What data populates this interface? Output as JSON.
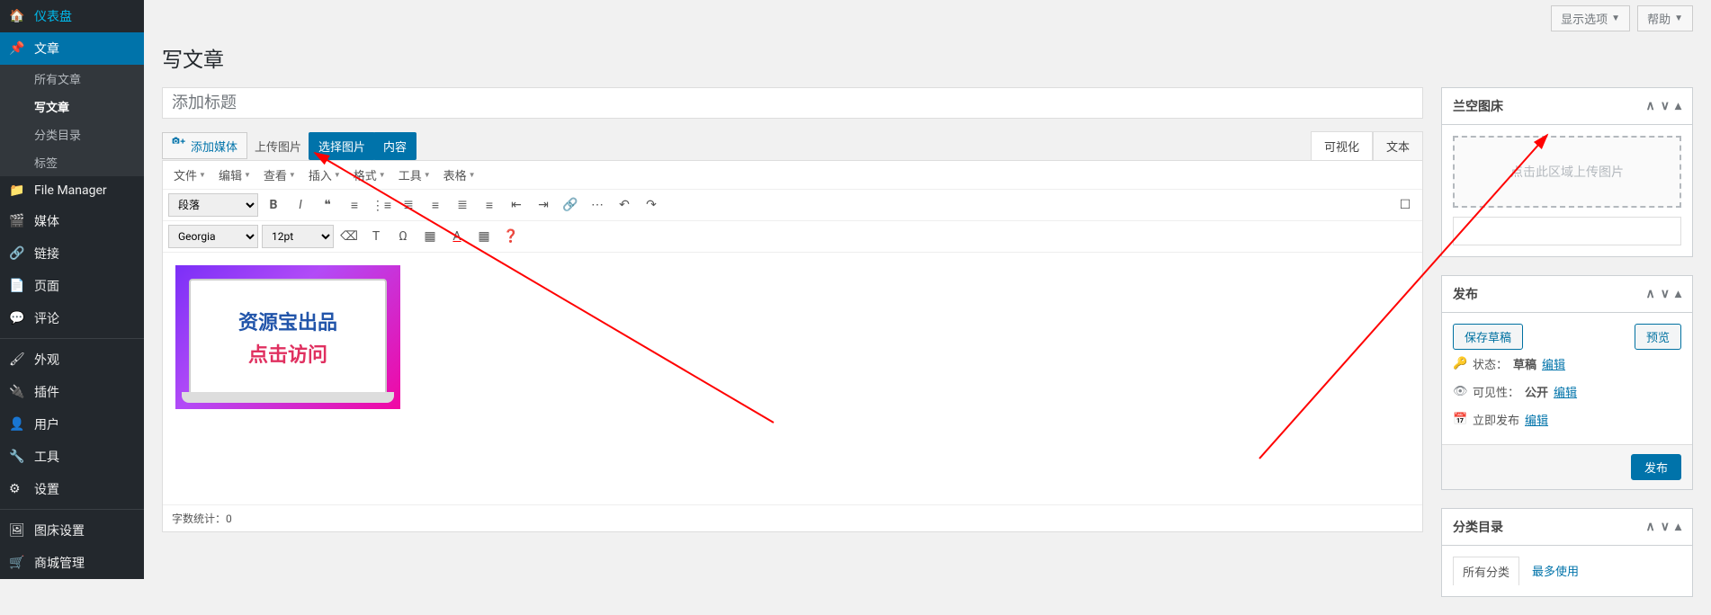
{
  "sidebar": {
    "items": [
      {
        "icon": "dashboard",
        "label": "仪表盘"
      },
      {
        "icon": "pin",
        "label": "文章",
        "current": true
      },
      {
        "icon": "folder",
        "label": "File Manager"
      },
      {
        "icon": "media",
        "label": "媒体"
      },
      {
        "icon": "link",
        "label": "链接"
      },
      {
        "icon": "page",
        "label": "页面"
      },
      {
        "icon": "comment",
        "label": "评论"
      },
      {
        "icon": "brush",
        "label": "外观"
      },
      {
        "icon": "plugin",
        "label": "插件"
      },
      {
        "icon": "user",
        "label": "用户"
      },
      {
        "icon": "wrench",
        "label": "工具"
      },
      {
        "icon": "gear",
        "label": "设置"
      },
      {
        "icon": "image",
        "label": "图床设置"
      },
      {
        "icon": "cart",
        "label": "商城管理"
      }
    ],
    "subitems": [
      "所有文章",
      "写文章",
      "分类目录",
      "标签"
    ],
    "sub_active_index": 1
  },
  "topbar": {
    "screen_options": "显示选项",
    "help": "帮助"
  },
  "page": {
    "title": "写文章",
    "title_placeholder": "添加标题"
  },
  "media_row": {
    "add_media": "添加媒体",
    "upload_img": "上传图片",
    "select_img": "选择图片",
    "content": "内容",
    "tab_visual": "可视化",
    "tab_text": "文本"
  },
  "menubar": [
    "文件",
    "编辑",
    "查看",
    "插入",
    "格式",
    "工具",
    "表格"
  ],
  "toolbar1": {
    "format_select": "段落"
  },
  "toolbar2": {
    "font_select": "Georgia",
    "size_select": "12pt"
  },
  "editor_image": {
    "line1": "资源宝出品",
    "line2": "点击访问"
  },
  "word_count": {
    "label": "字数统计：",
    "value": "0"
  },
  "box_image": {
    "title": "兰空图床",
    "upload_hint": "点击此区域上传图片"
  },
  "box_publish": {
    "title": "发布",
    "save_draft": "保存草稿",
    "preview": "预览",
    "status_label": "状态：",
    "status_value": "草稿",
    "status_edit": "编辑",
    "visibility_label": "可见性：",
    "visibility_value": "公开",
    "visibility_edit": "编辑",
    "schedule_label": "立即发布",
    "schedule_edit": "编辑",
    "publish_btn": "发布"
  },
  "box_categories": {
    "title": "分类目录",
    "tab_all": "所有分类",
    "tab_most": "最多使用"
  }
}
